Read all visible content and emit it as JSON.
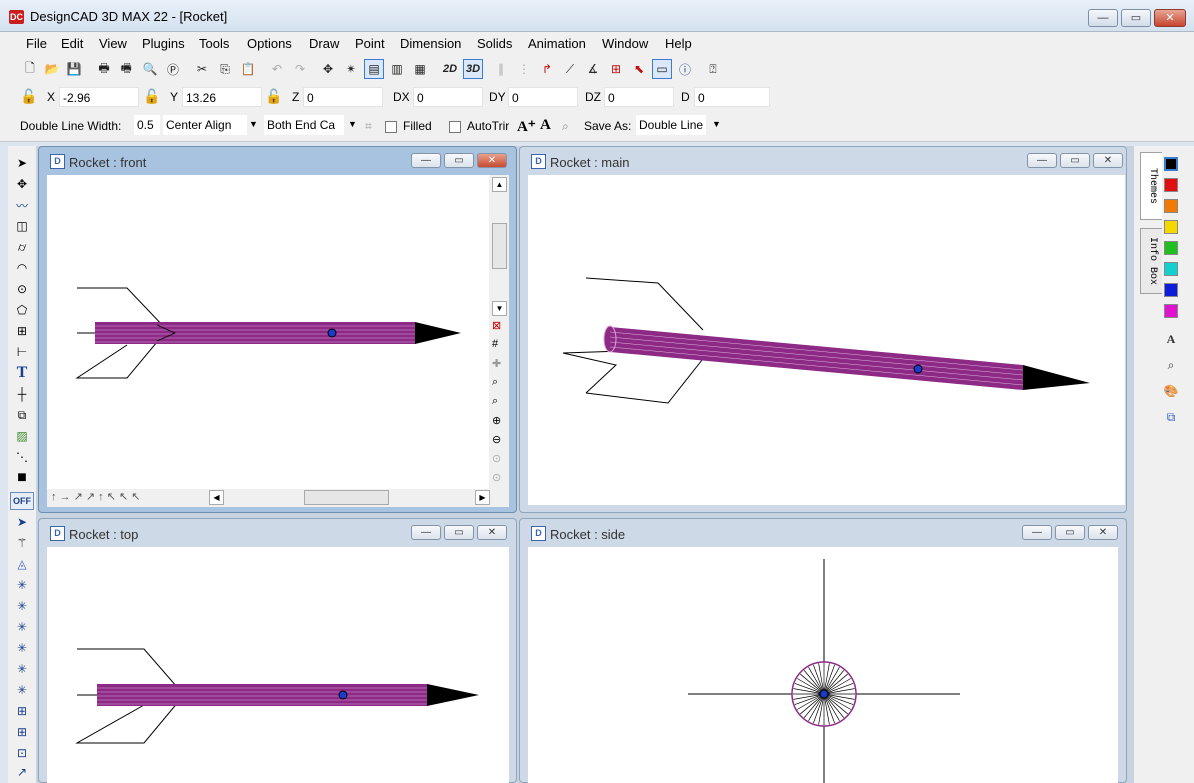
{
  "app": {
    "title": "DesignCAD 3D MAX 22 - [Rocket]",
    "icon_text": "DC"
  },
  "window_buttons": {
    "minimize": "—",
    "restore": "▭",
    "close": "✕"
  },
  "menu": [
    "File",
    "Edit",
    "View",
    "Plugins",
    "Tools",
    "Options",
    "Draw",
    "Point",
    "Dimension",
    "Solids",
    "Animation",
    "Window",
    "Help"
  ],
  "coords": {
    "x_label": "X",
    "x_value": "-2.96",
    "y_label": "Y",
    "y_value": "13.26",
    "z_label": "Z",
    "z_value": "0",
    "dx_label": "DX",
    "dx_value": "0",
    "dy_label": "DY",
    "dy_value": "0",
    "dz_label": "DZ",
    "dz_value": "0",
    "d_label": "D",
    "d_value": "0"
  },
  "props": {
    "line_width_label": "Double Line Width:",
    "line_width_value": "0.5",
    "align_value": "Center Align",
    "cap_value": "Both End Ca",
    "filled_label": "Filled",
    "autotrim_label": "AutoTrir",
    "save_as_label": "Save As:",
    "save_as_value": "Double Line"
  },
  "toolbar": {
    "mode_2d": "2D",
    "mode_3d": "3D"
  },
  "viewports": {
    "front": {
      "title": "Rocket : front"
    },
    "main": {
      "title": "Rocket : main"
    },
    "top": {
      "title": "Rocket : top"
    },
    "side": {
      "title": "Rocket : side"
    }
  },
  "left_tools": {
    "off_label": "OFF",
    "text_tool": "T"
  },
  "right_panel": {
    "tabs": [
      "Themes",
      "Info Box"
    ],
    "colors": [
      "#000000",
      "#e01010",
      "#f07b00",
      "#f5d800",
      "#1fbf1f",
      "#12d0d0",
      "#0e1ed8",
      "#e012d0"
    ]
  },
  "colors": {
    "rocket": "#8c2a86",
    "marker": "#1a3cc8"
  }
}
